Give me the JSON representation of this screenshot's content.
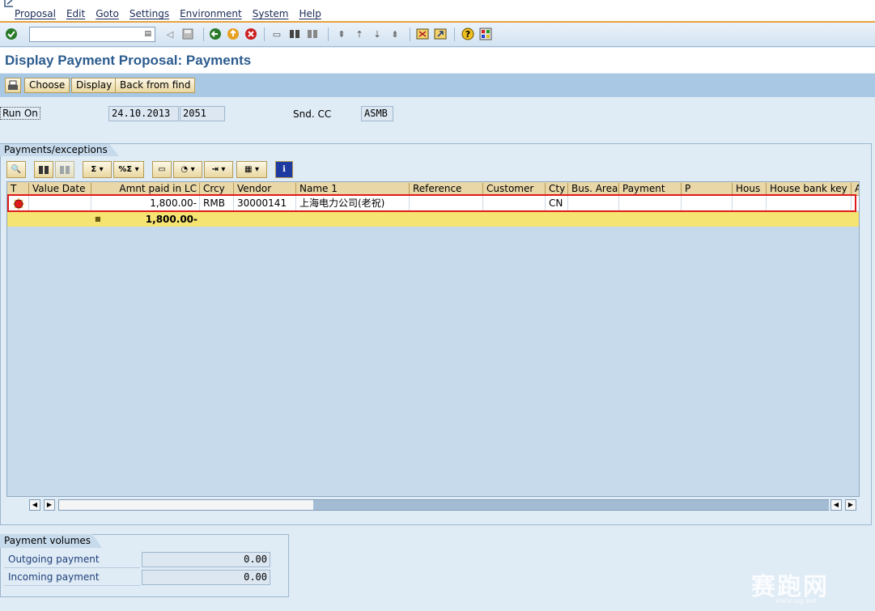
{
  "menu": [
    "Proposal",
    "Edit",
    "Goto",
    "Settings",
    "Environment",
    "System",
    "Help"
  ],
  "command_field": {
    "value": ""
  },
  "title": "Display Payment Proposal: Payments",
  "app_toolbar": {
    "choose": "Choose",
    "display": "Display",
    "back_from_find": "Back from find"
  },
  "header": {
    "run_on_label": "Run On",
    "run_on_date": "24.10.2013",
    "run_on_id": "2051",
    "snd_cc_label": "Snd. CC",
    "snd_cc_value": "ASMB"
  },
  "payments_group": {
    "title": "Payments/exceptions",
    "columns": [
      "T",
      "Value Date",
      "Amnt paid in LC",
      "Crcy",
      "Vendor",
      "Name 1",
      "Reference",
      "Customer",
      "Cty",
      "Bus. Area",
      "Payment",
      "P",
      "Hous",
      "House bank key",
      "A"
    ],
    "rows": [
      {
        "t": "",
        "value_date": "",
        "amount": "1,800.00-",
        "crcy": "RMB",
        "vendor": "30000141",
        "name1": "上海电力公司(老祝)",
        "reference": "",
        "customer": "",
        "cty": "CN",
        "bus_area": "",
        "payment": "",
        "p": "",
        "hous": "",
        "house_bank_key": ""
      }
    ],
    "total": "1,800.00-"
  },
  "payment_volumes": {
    "title": "Payment volumes",
    "outgoing_label": "Outgoing payment",
    "outgoing_value": "0.00",
    "incoming_label": "Incoming payment",
    "incoming_value": "0.00"
  },
  "watermark": {
    "text": "赛跑网",
    "sub": "www.ssp.net"
  },
  "colors": {
    "title": "#2c5c8f",
    "total_row": "#f5e372",
    "highlight": "#e01a1a",
    "header_row": "#e9d7a8"
  }
}
